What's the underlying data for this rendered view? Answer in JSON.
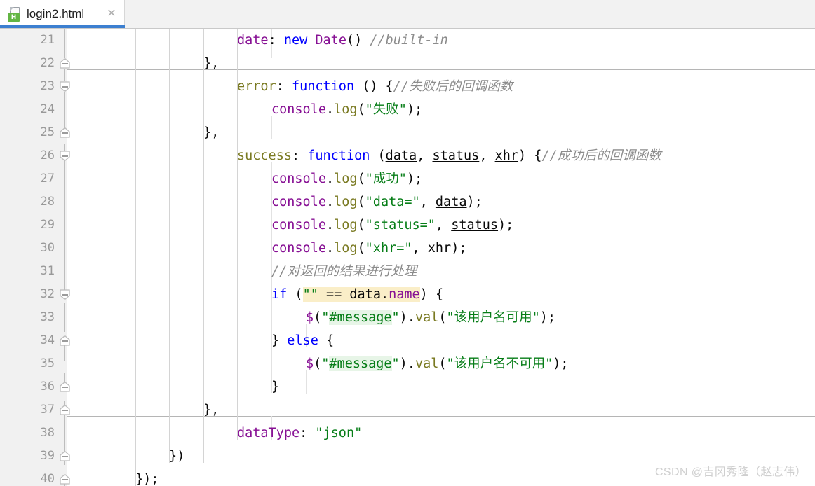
{
  "tab": {
    "label": "login2.html",
    "icon": "html-file-icon",
    "icon_badge": "H",
    "close_label": "✕",
    "accent_color": "#3c7fd0"
  },
  "editor": {
    "first_line": 21,
    "last_line": 40,
    "line_numbers": [
      "21",
      "22",
      "23",
      "24",
      "25",
      "26",
      "27",
      "28",
      "29",
      "30",
      "31",
      "32",
      "33",
      "34",
      "35",
      "36",
      "37",
      "38",
      "39",
      "40"
    ],
    "fold_markers": [
      {
        "line": 22,
        "type": "fold-end"
      },
      {
        "line": 23,
        "type": "fold-start"
      },
      {
        "line": 25,
        "type": "fold-end"
      },
      {
        "line": 26,
        "type": "fold-start"
      },
      {
        "line": 32,
        "type": "fold-start"
      },
      {
        "line": 34,
        "type": "fold-end"
      },
      {
        "line": 36,
        "type": "fold-end"
      },
      {
        "line": 37,
        "type": "fold-end"
      },
      {
        "line": 39,
        "type": "fold-end"
      },
      {
        "line": 40,
        "type": "fold-end"
      }
    ],
    "highlights": {
      "search_match": "#faeec8",
      "usage_match": "#e7f5e7"
    },
    "lines": {
      "21": "            date: new Date() //built-in",
      "22": "        },",
      "23": "        error: function () {//失败后的回调函数",
      "24": "            console.log(\"失败\");",
      "25": "        },",
      "26": "        success: function (data, status, xhr) {//成功后的回调函数",
      "27": "            console.log(\"成功\");",
      "28": "            console.log(\"data=\", data);",
      "29": "            console.log(\"status=\", status);",
      "30": "            console.log(\"xhr=\", xhr);",
      "31": "            //对返回的结果进行处理",
      "32": "            if (\"\" == data.name) {",
      "33": "                $(\"#message\").val(\"该用户名可用\");",
      "34": "            } else {",
      "35": "                $(\"#message\").val(\"该用户名不可用\");",
      "36": "            }",
      "37": "        },",
      "38": "        dataType: \"json\"",
      "39": "    })",
      "40": "});"
    },
    "tokens": {
      "l21": {
        "t1": "date",
        "t2": ": ",
        "t3": "new",
        "t4": " ",
        "t5": "Date",
        "t6": "() ",
        "t7": "//built-in"
      },
      "l22": {
        "t1": "},"
      },
      "l23": {
        "t1": "error",
        "t2": ": ",
        "t3": "function",
        "t4": " () {",
        "t5": "//失败后的回调函数"
      },
      "l24": {
        "t1": "console",
        "t2": ".",
        "t3": "log",
        "t4": "(",
        "t5": "\"失败\"",
        "t6": ");"
      },
      "l25": {
        "t1": "},"
      },
      "l26": {
        "t1": "success",
        "t2": ": ",
        "t3": "function",
        "t4": " (",
        "t5": "data",
        "t6": ", ",
        "t7": "status",
        "t8": ", ",
        "t9": "xhr",
        "t10": ") {",
        "t11": "//成功后的回调函数"
      },
      "l27": {
        "t1": "console",
        "t2": ".",
        "t3": "log",
        "t4": "(",
        "t5": "\"成功\"",
        "t6": ");"
      },
      "l28": {
        "t1": "console",
        "t2": ".",
        "t3": "log",
        "t4": "(",
        "t5": "\"data=\"",
        "t6": ", ",
        "t7": "data",
        "t8": ");"
      },
      "l29": {
        "t1": "console",
        "t2": ".",
        "t3": "log",
        "t4": "(",
        "t5": "\"status=\"",
        "t6": ", ",
        "t7": "status",
        "t8": ");"
      },
      "l30": {
        "t1": "console",
        "t2": ".",
        "t3": "log",
        "t4": "(",
        "t5": "\"xhr=\"",
        "t6": ", ",
        "t7": "xhr",
        "t8": ");"
      },
      "l31": {
        "t1": "//对返回的结果进行处理"
      },
      "l32": {
        "t1": "if",
        "t2": " (",
        "t3": "\"\"",
        "t4": " == ",
        "t5": "data",
        "t6": ".",
        "t7": "name",
        "t8": ") {"
      },
      "l33": {
        "t1": "$",
        "t2": "(",
        "t3": "\"",
        "t4": "#message",
        "t5": "\"",
        "t6": ")",
        "t7": ".",
        "t8": "val",
        "t9": "(",
        "t10": "\"该用户名可用\"",
        "t11": ");"
      },
      "l34": {
        "t1": "} ",
        "t2": "else",
        "t3": " {"
      },
      "l35": {
        "t1": "$",
        "t2": "(",
        "t3": "\"",
        "t4": "#message",
        "t5": "\"",
        "t6": ")",
        "t7": ".",
        "t8": "val",
        "t9": "(",
        "t10": "\"该用户名不可用\"",
        "t11": ");"
      },
      "l36": {
        "t1": "}"
      },
      "l37": {
        "t1": "},"
      },
      "l38": {
        "t1": "dataType",
        "t2": ": ",
        "t3": "\"json\""
      },
      "l39": {
        "t1": "})"
      },
      "l40": {
        "t1": "});"
      }
    }
  },
  "watermark": {
    "text": "CSDN @吉冈秀隆（赵志伟）"
  }
}
